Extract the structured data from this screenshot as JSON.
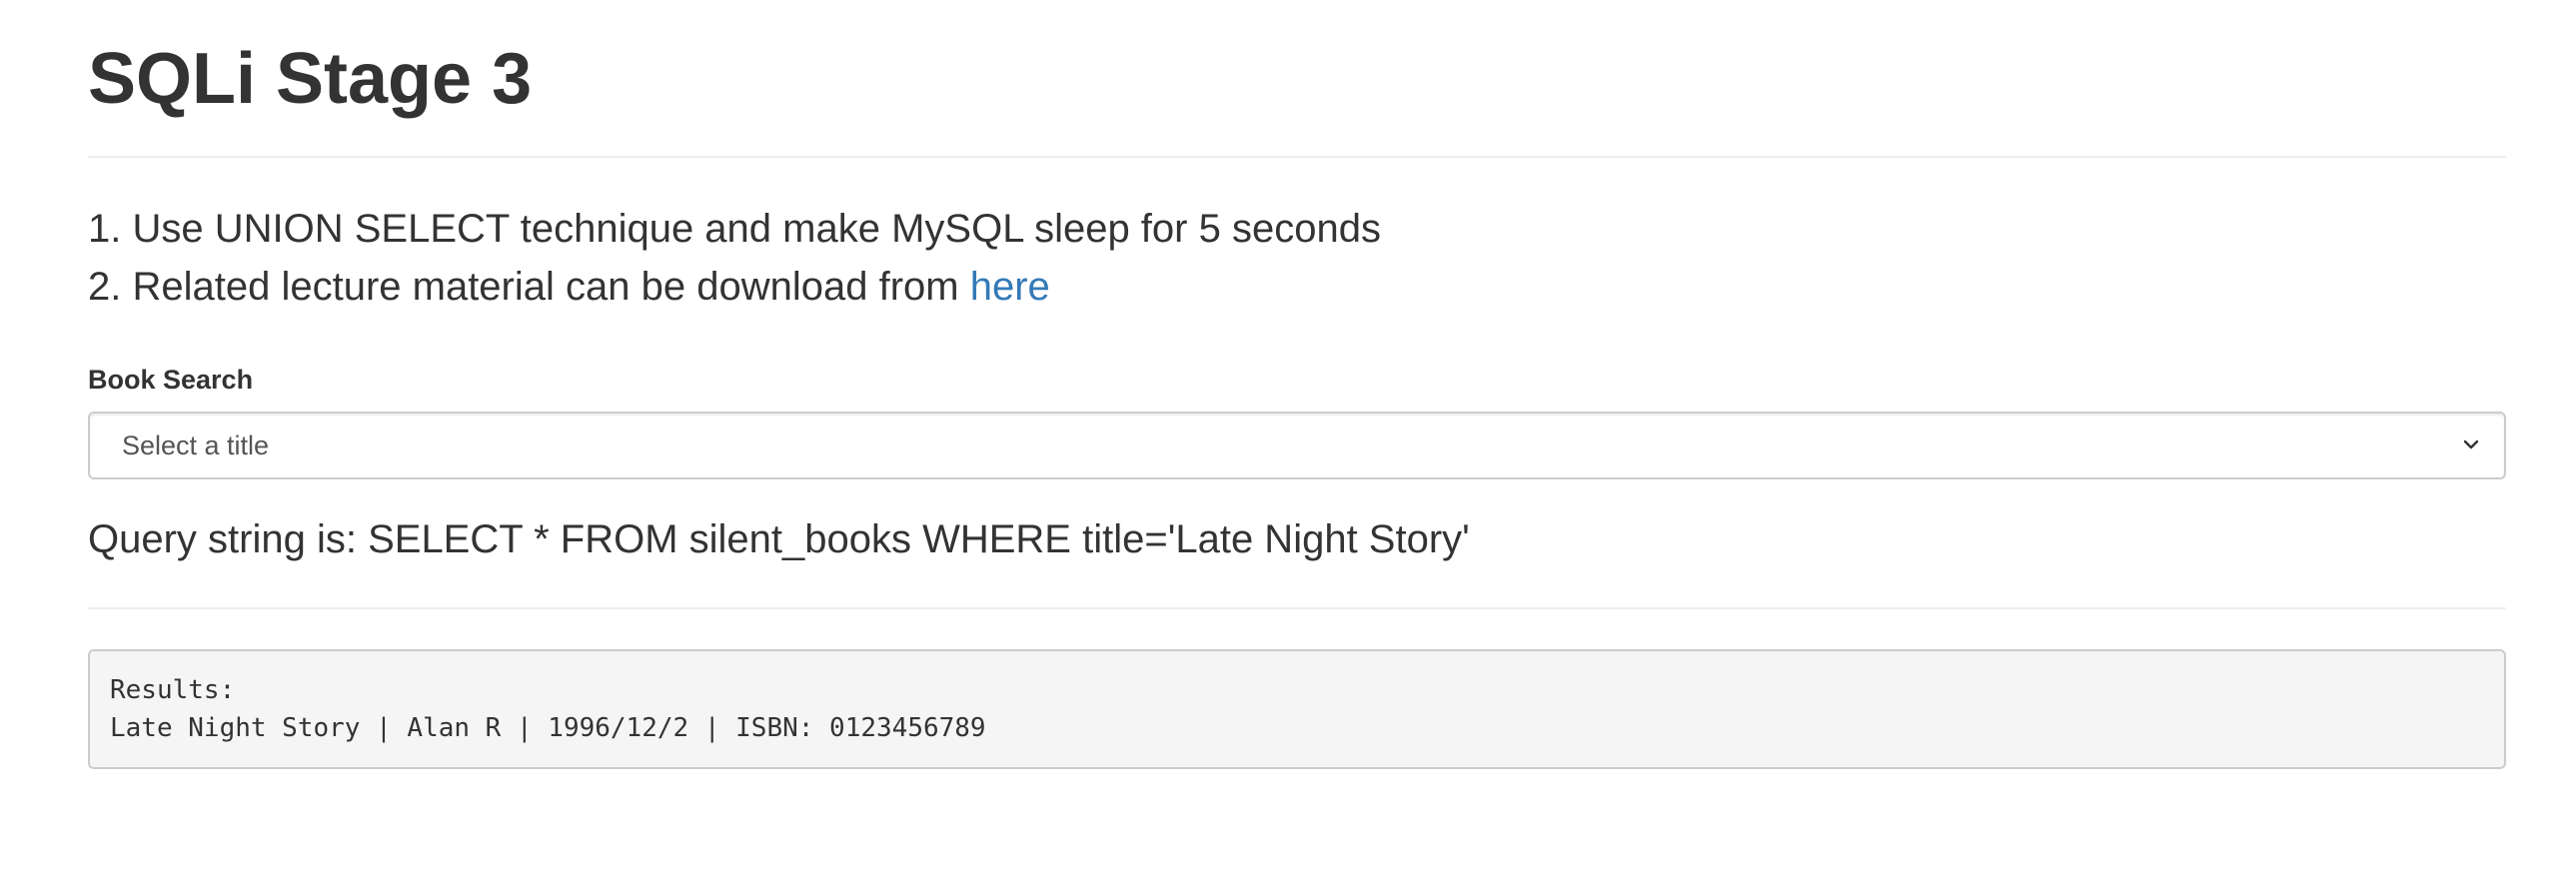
{
  "page": {
    "title": "SQLi Stage 3"
  },
  "instructions": {
    "item1": "1. Use UNION SELECT technique and make MySQL sleep for 5 seconds",
    "item2_prefix": "2. Related lecture material can be download from ",
    "item2_link": "here"
  },
  "book_search": {
    "label": "Book Search",
    "selected_value": "Select a title",
    "icon": "chevron-down-icon"
  },
  "query": {
    "text": "Query string is: SELECT * FROM silent_books WHERE title='Late Night Story'"
  },
  "results": {
    "heading": "Results:",
    "row": "Late Night Story | Alan R | 1996/12/2 | ISBN: 0123456789"
  },
  "colors": {
    "text": "#333333",
    "link": "#337ab7",
    "results_bg": "#f5f5f5",
    "border": "#cccccc",
    "rule": "#eeeeee"
  }
}
